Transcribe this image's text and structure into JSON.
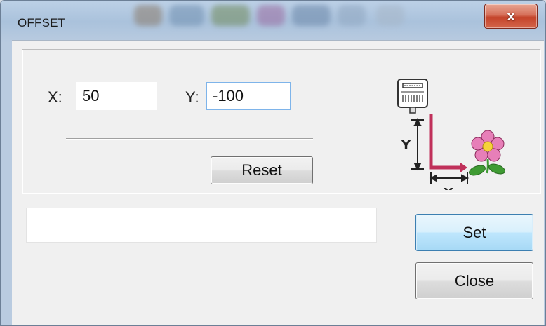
{
  "window": {
    "title": "OFFSET",
    "close_glyph": "x"
  },
  "offset": {
    "x_label": "X:",
    "x_value": "50",
    "y_label": "Y:",
    "y_value": "-100",
    "reset_label": "Reset"
  },
  "illustration": {
    "y_axis_label": "Y",
    "x_axis_label": "X",
    "icons": [
      "embroidery-machine-head-icon",
      "flower-icon"
    ],
    "colors": {
      "arrow": "#c0305a",
      "flower_petal": "#e77fb8",
      "flower_center": "#f6d23a",
      "leaf": "#3f9b33"
    }
  },
  "status": {
    "text": ""
  },
  "actions": {
    "set_label": "Set",
    "close_label": "Close"
  }
}
